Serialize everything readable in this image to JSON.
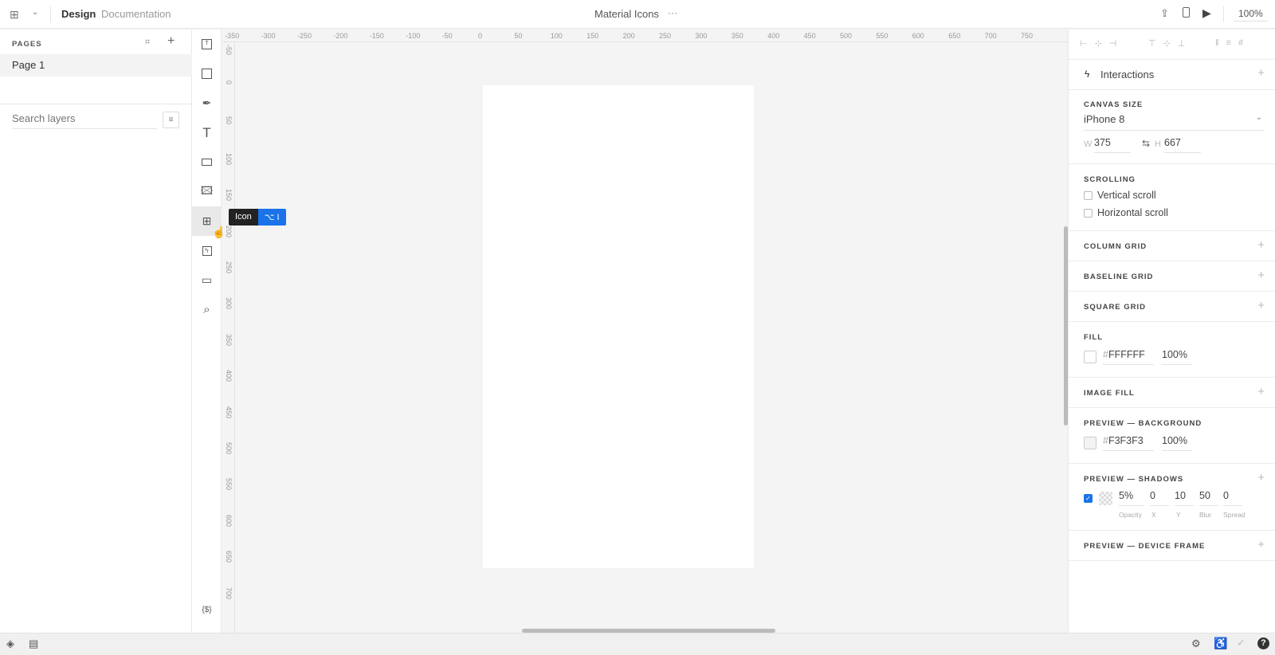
{
  "topbar": {
    "design_tab": "Design",
    "documentation_tab": "Documentation",
    "file_title": "Material Icons",
    "more": "···",
    "zoom": "100%"
  },
  "pages": {
    "header": "PAGES",
    "items": [
      "Page 1"
    ],
    "search_placeholder": "Search layers"
  },
  "tooltip": {
    "label": "Icon",
    "shortcut": "⌥ I"
  },
  "rulers": {
    "x_ticks": [
      "-350",
      "-300",
      "-250",
      "-200",
      "-150",
      "-100",
      "-50",
      "0",
      "50",
      "100",
      "150",
      "200",
      "250",
      "300",
      "350",
      "400",
      "450",
      "500",
      "550",
      "600",
      "650",
      "700",
      "750"
    ],
    "y_ticks": [
      "-50",
      "0",
      "50",
      "100",
      "150",
      "200",
      "250",
      "300",
      "350",
      "400",
      "450",
      "500",
      "550",
      "600",
      "650",
      "700"
    ]
  },
  "variables_button": "{$}",
  "inspector": {
    "interactions": "Interactions",
    "canvas_size": {
      "label": "CANVAS SIZE",
      "device": "iPhone 8",
      "w_label": "W",
      "w": "375",
      "h_label": "H",
      "h": "667"
    },
    "scrolling": {
      "label": "SCROLLING",
      "vertical": "Vertical scroll",
      "horizontal": "Horizontal scroll"
    },
    "column_grid": "COLUMN GRID",
    "baseline_grid": "BASELINE GRID",
    "square_grid": "SQUARE GRID",
    "fill": {
      "label": "FILL",
      "hash": "#",
      "hex": "FFFFFF",
      "opacity": "100%",
      "color": "#FFFFFF"
    },
    "image_fill": "IMAGE FILL",
    "preview_bg": {
      "label": "PREVIEW — BACKGROUND",
      "hash": "#",
      "hex": "F3F3F3",
      "opacity": "100%",
      "color": "#F3F3F3"
    },
    "shadows": {
      "label": "PREVIEW — SHADOWS",
      "opacity": "5%",
      "x": "0",
      "y": "10",
      "blur": "50",
      "spread": "0",
      "opacity_label": "Opacity",
      "x_label": "X",
      "y_label": "Y",
      "blur_label": "Blur",
      "spread_label": "Spread",
      "enabled": true
    },
    "device_frame": "PREVIEW — DEVICE FRAME"
  },
  "colors": {
    "accent": "#1a73e8",
    "tooltip_bg": "#222222"
  }
}
